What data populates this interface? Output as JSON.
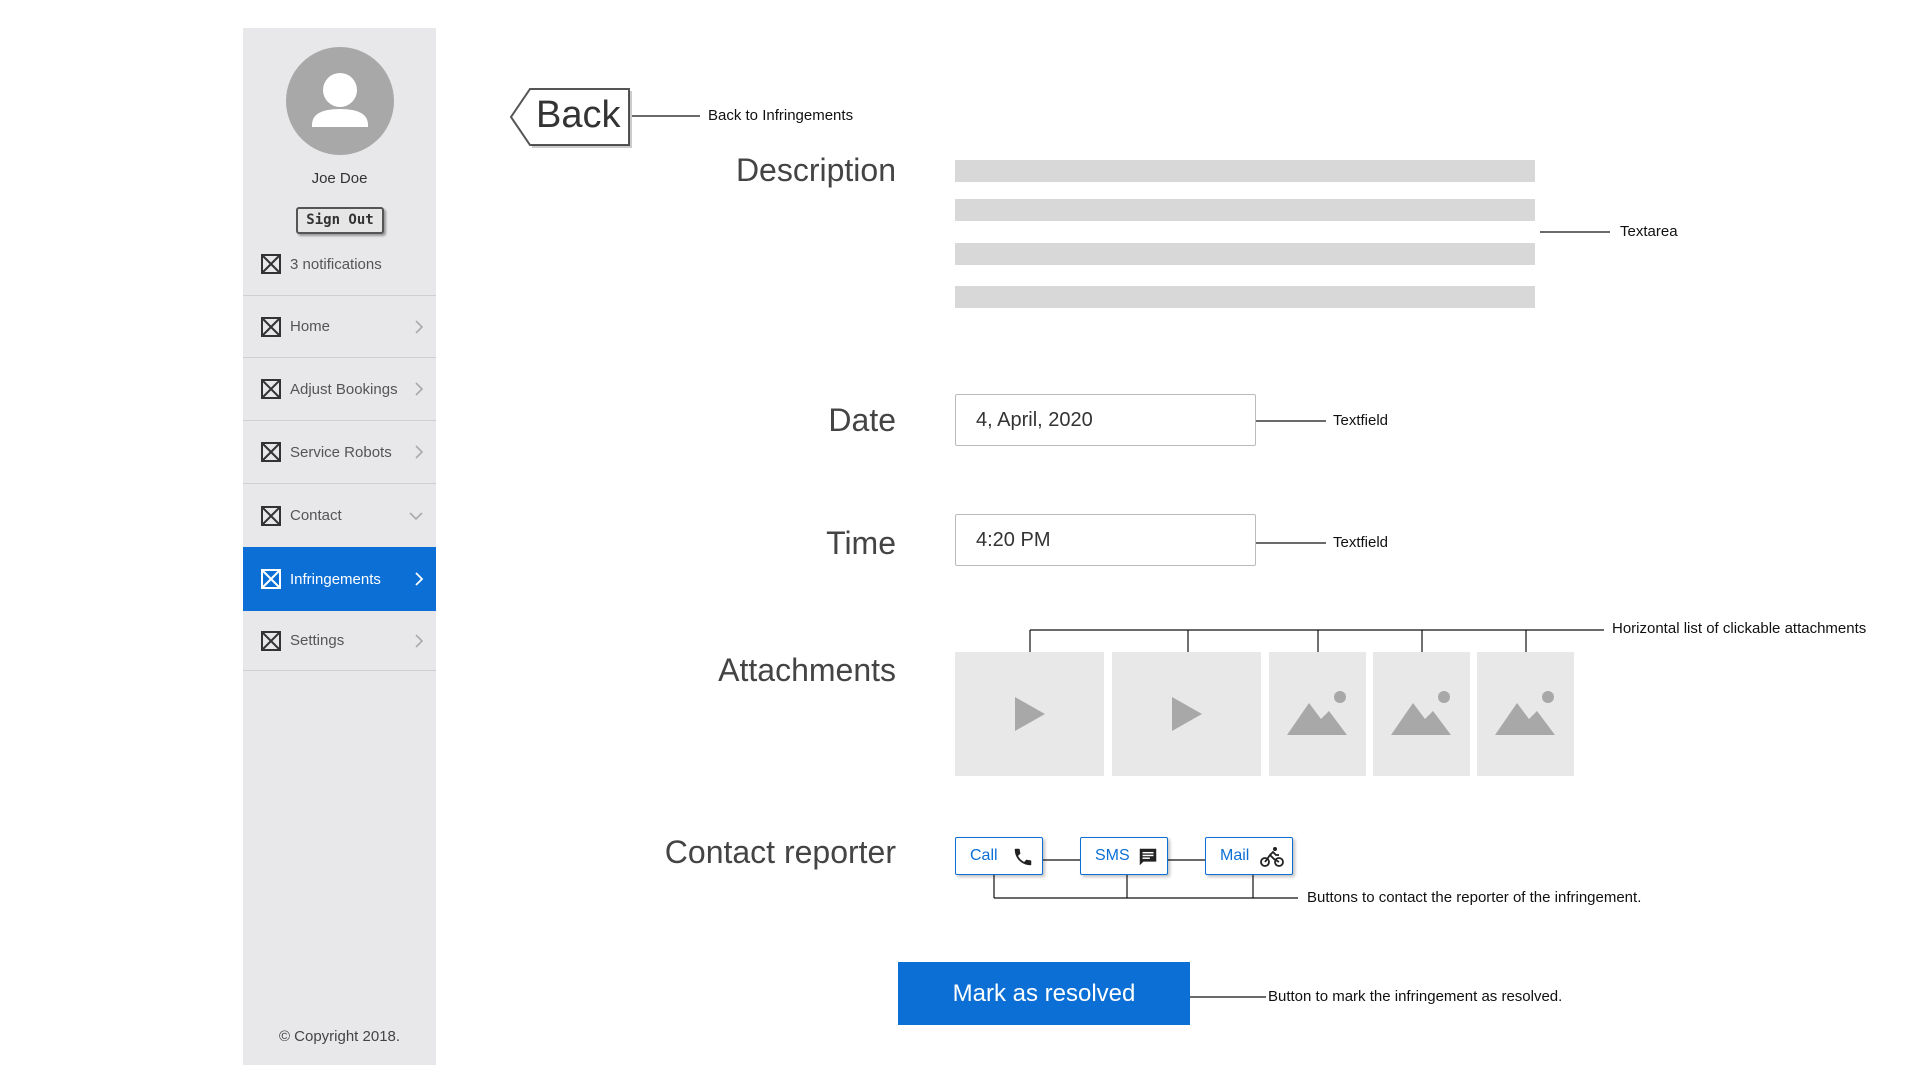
{
  "sidebar": {
    "user_name": "Joe Doe",
    "sign_out": "Sign Out",
    "notifications": "3 notifications",
    "items": [
      {
        "label": "Home",
        "chevron": "chevron-right-icon"
      },
      {
        "label": "Adjust Bookings",
        "chevron": "chevron-right-icon"
      },
      {
        "label": "Service Robots",
        "chevron": "chevron-right-icon"
      },
      {
        "label": "Contact",
        "chevron": "chevron-down-icon"
      },
      {
        "label": "Infringements",
        "chevron": "chevron-right-icon",
        "active": true
      },
      {
        "label": "Settings",
        "chevron": "chevron-right-icon"
      }
    ],
    "copyright": "© Copyright 2018."
  },
  "main": {
    "back_label": "Back",
    "description_label": "Description",
    "date_label": "Date",
    "date_value": "4, April, 2020",
    "time_label": "Time",
    "time_value": "4:20 PM",
    "attachments_label": "Attachments",
    "attachments": [
      "video",
      "video",
      "image",
      "image",
      "image"
    ],
    "contact_label": "Contact reporter",
    "contact_buttons": {
      "call": "Call",
      "sms": "SMS",
      "mail": "Mail"
    },
    "resolve_button": "Mark as resolved"
  },
  "annotations": {
    "back": "Back to Infringements",
    "textarea": "Textarea",
    "date_field": "Textfield",
    "time_field": "Textfield",
    "attachments": "Horizontal list of clickable attachments",
    "contact": "Buttons to contact the reporter of the infringement.",
    "resolve": "Button to mark the infringement as resolved."
  },
  "colors": {
    "accent": "#0b6fd6",
    "sidebar_bg": "#e8e8ea",
    "placeholder": "#d8d8d8"
  }
}
